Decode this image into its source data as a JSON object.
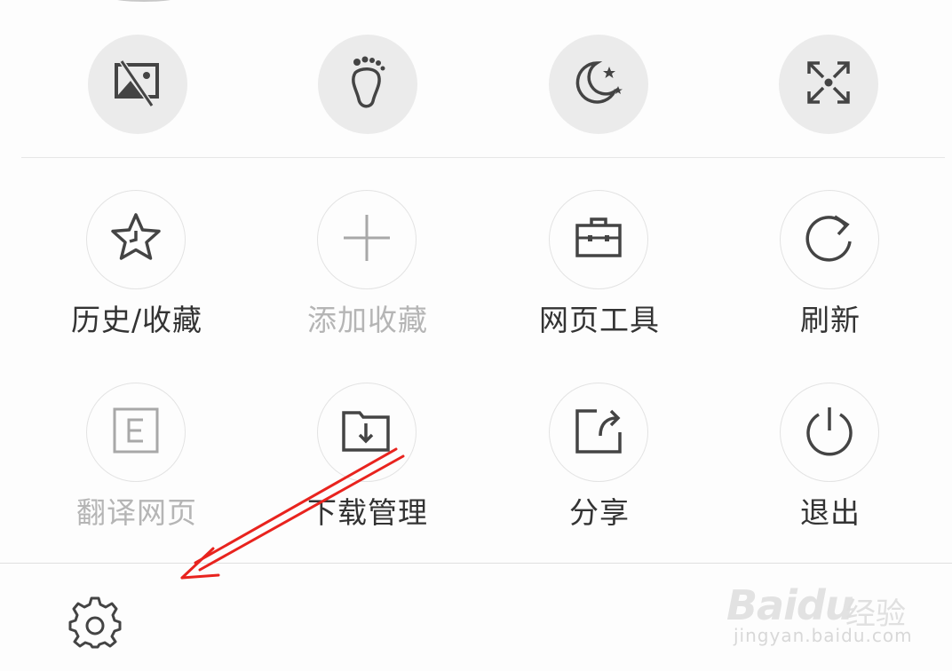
{
  "quick_actions": [
    {
      "name": "no-image-mode",
      "icon": "no-image-icon"
    },
    {
      "name": "incognito-mode",
      "icon": "footprint-icon"
    },
    {
      "name": "night-mode",
      "icon": "moon-icon"
    },
    {
      "name": "fullscreen",
      "icon": "fullscreen-icon"
    }
  ],
  "menu": {
    "history": {
      "label": "历史/收藏",
      "icon": "star-clock-icon"
    },
    "add_favorite": {
      "label": "添加收藏",
      "icon": "plus-icon",
      "disabled": true
    },
    "web_tools": {
      "label": "网页工具",
      "icon": "toolbox-icon"
    },
    "refresh": {
      "label": "刷新",
      "icon": "refresh-icon"
    },
    "translate": {
      "label": "翻译网页",
      "icon": "translate-e-icon",
      "disabled": true
    },
    "downloads": {
      "label": "下载管理",
      "icon": "download-folder-icon"
    },
    "share": {
      "label": "分享",
      "icon": "share-icon"
    },
    "exit": {
      "label": "退出",
      "icon": "power-icon"
    }
  },
  "footer": {
    "settings_icon": "gear-icon"
  },
  "watermark": {
    "brand": "Baidu",
    "cn": "经验",
    "url": "jingyan.baidu.com"
  },
  "annotation": {
    "arrow_color": "#e8231e"
  },
  "colors": {
    "icon_dark": "#444444",
    "icon_disabled": "#a8a8a8",
    "quick_bg": "#ebebeb"
  }
}
